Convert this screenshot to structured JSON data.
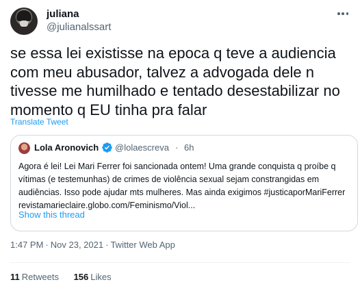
{
  "author": {
    "display_name": "juliana",
    "handle": "@julianalssart"
  },
  "tweet": {
    "text": "se essa lei existisse na epoca q teve a audiencia com meu abusador, talvez a advogada dele n tivesse me humilhado e tentado desestabilizar no momento q EU tinha pra falar",
    "translate_label": "Translate Tweet"
  },
  "quote": {
    "display_name": "Lola Aronovich",
    "handle": "@lolaescreva",
    "separator": "·",
    "time": "6h",
    "text": "Agora é lei! Lei Mari Ferrer foi sancionada ontem! Uma grande conquista q proíbe q vítimas (e testemunhas) de crimes de violência sexual sejam constrangidas em audiências. Isso pode ajudar mts mulheres. Mas ainda exigimos #justicaporMariFerrer revistamarieclaire.globo.com/Feminismo/Viol...",
    "show_thread_label": "Show this thread"
  },
  "meta": {
    "time": "1:47 PM",
    "date": "Nov 23, 2021",
    "source": "Twitter Web App",
    "separator": "·"
  },
  "stats": {
    "retweets_count": "11",
    "retweets_label": "Retweets",
    "likes_count": "156",
    "likes_label": "Likes"
  },
  "colors": {
    "link_blue": "#1d9bf0",
    "secondary_text": "#536471",
    "border": "#cfd9de"
  }
}
